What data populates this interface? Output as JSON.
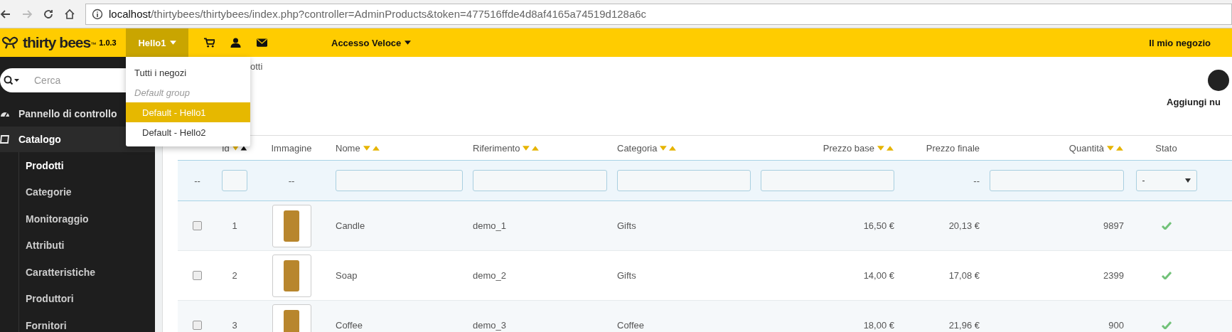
{
  "browser": {
    "url_host": "localhost",
    "url_path": "/thirtybees/thirtybees/index.php?controller=AdminProducts&token=477516ffde4d8af4165a74519d128a6c",
    "forward_disabled": true
  },
  "header": {
    "logo": "thirty bees",
    "trademark": "™",
    "version": "1.0.3",
    "shop_selector": "Hello1",
    "quick_access": "Accesso Veloce",
    "shop_link": "Il mio negozio"
  },
  "shop_menu": [
    {
      "label": "Tutti i negozi",
      "kind": "item",
      "selected": false
    },
    {
      "label": "Default group",
      "kind": "group"
    },
    {
      "label": "Default - Hello1",
      "kind": "shop",
      "selected": true
    },
    {
      "label": "Default - Hello2",
      "kind": "shop",
      "selected": false
    }
  ],
  "sidebar": {
    "search_placeholder": "Cerca",
    "items": [
      {
        "label": "Pannello di controllo",
        "selected": false
      },
      {
        "label": "Catalogo",
        "selected": true,
        "children": [
          {
            "label": "Prodotti",
            "selected": true
          },
          {
            "label": "Categorie",
            "selected": false
          },
          {
            "label": "Monitoraggio",
            "selected": false
          },
          {
            "label": "Attributi",
            "selected": false
          },
          {
            "label": "Caratteristiche",
            "selected": false
          },
          {
            "label": "Produttori",
            "selected": false
          },
          {
            "label": "Fornitori",
            "selected": false
          }
        ]
      }
    ]
  },
  "breadcrumb": "otti",
  "toolbar": {
    "add_label": "Aggiungi nu"
  },
  "table": {
    "columns": [
      {
        "label": "Id",
        "sortable": true,
        "sorted_asc": true
      },
      {
        "label": "Immagine",
        "sortable": false
      },
      {
        "label": "Nome",
        "sortable": true,
        "sorted_asc": false
      },
      {
        "label": "Riferimento",
        "sortable": true,
        "sorted_asc": false
      },
      {
        "label": "Categoria",
        "sortable": true,
        "sorted_asc": false
      },
      {
        "label": "Prezzo base",
        "sortable": true,
        "sorted_asc": false
      },
      {
        "label": "Prezzo finale",
        "sortable": false
      },
      {
        "label": "Quantità",
        "sortable": true,
        "sorted_asc": false
      },
      {
        "label": "Stato",
        "sortable": false
      }
    ],
    "filter_dash": "--",
    "select_value": "-",
    "rows": [
      {
        "selected": false,
        "id": "1",
        "name": "Candle",
        "reference": "demo_1",
        "category": "Gifts",
        "base_price": "16,50 €",
        "final_price": "20,13 €",
        "quantity": "9897",
        "enabled": true
      },
      {
        "selected": false,
        "id": "2",
        "name": "Soap",
        "reference": "demo_2",
        "category": "Gifts",
        "base_price": "14,00 €",
        "final_price": "17,08 €",
        "quantity": "2399",
        "enabled": true
      },
      {
        "selected": false,
        "id": "3",
        "name": "Coffee",
        "reference": "demo_3",
        "category": "Coffee",
        "base_price": "18,00 €",
        "final_price": "21,96 €",
        "quantity": "900",
        "enabled": true
      }
    ]
  }
}
